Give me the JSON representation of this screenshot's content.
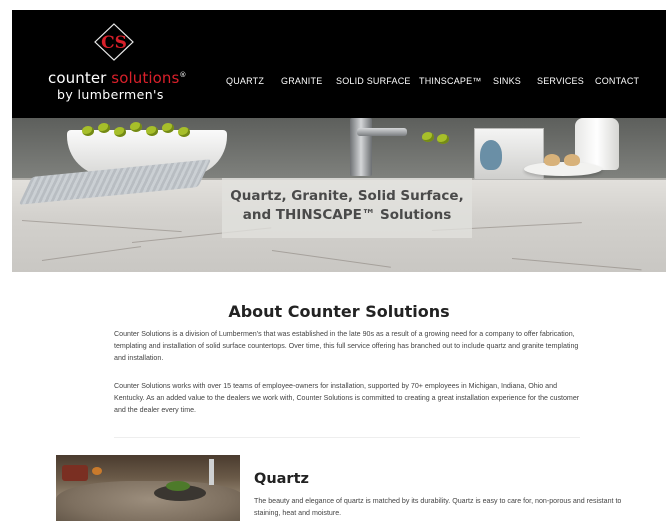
{
  "header": {
    "logo": {
      "monogram": "CS",
      "line1_a": "counter ",
      "line1_b": "solutions",
      "registered": "®",
      "line2": "by lumbermen's"
    },
    "nav": [
      {
        "label": "QUARTZ"
      },
      {
        "label": "GRANITE"
      },
      {
        "label": "SOLID SURFACE"
      },
      {
        "label": "THINSCAPE™"
      },
      {
        "label": "SINKS"
      },
      {
        "label": "SERVICES"
      },
      {
        "label": "CONTACT"
      }
    ]
  },
  "hero": {
    "title_line1": "Quartz, Granite, Solid Surface,",
    "title_line2": "and THINSCAPE™ Solutions"
  },
  "about": {
    "title": "About Counter Solutions",
    "para1": "Counter Solutions is a division of Lumbermen's that was established in the late 90s as a result of a growing need for a company to offer fabrication, templating and installation of solid surface countertops. Over time, this full service offering has branched out to include quartz and granite templating and installation.",
    "para2": "Counter Solutions works with over 15 teams of employee-owners for installation, supported by 70+ employees in Michigan, Indiana, Ohio and Kentucky. As an added value to the dealers we work with, Counter Solutions is committed to creating a great installation experience for the customer and the dealer every time."
  },
  "quartz": {
    "title": "Quartz",
    "description": "The beauty and elegance of quartz is matched by its durability. Quartz is easy to care for, non-porous and resistant to staining, heat and moisture."
  },
  "colors": {
    "header_bg": "#000000",
    "brand_red": "#d8202a",
    "text": "#444444"
  }
}
